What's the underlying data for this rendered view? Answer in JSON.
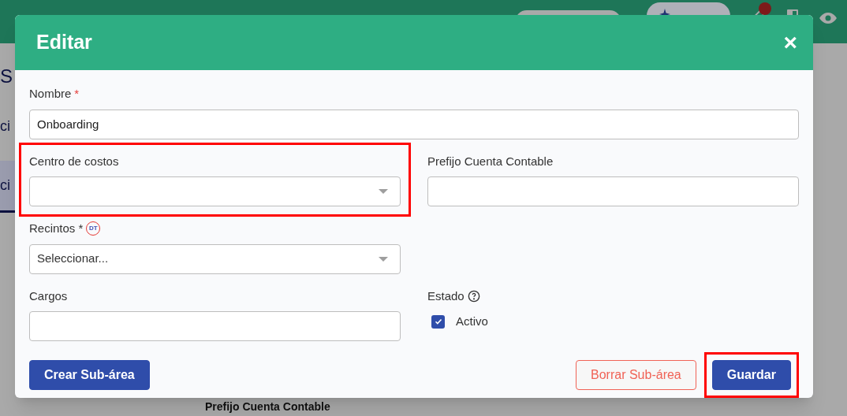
{
  "page": {
    "heading": "S",
    "tabs": [
      {
        "label": "ci",
        "selected": false
      },
      {
        "label": "ci",
        "selected": true
      }
    ],
    "topbar": {
      "notification": true
    },
    "footer_label": "Prefijo Cuenta Contable"
  },
  "dialog": {
    "title": "Editar",
    "close": "×",
    "fields": [
      {
        "kind": "text",
        "label": "Nombre",
        "required_mark": "*",
        "value": "Onboarding",
        "wide": true
      },
      {
        "kind": "select",
        "label": "Centro de costos",
        "highlighted": true
      },
      {
        "kind": "text",
        "label": "Prefijo Cuenta Contable"
      },
      {
        "kind": "select",
        "label": "Recintos *",
        "badge": "DT",
        "placeholder": "Seleccionar..."
      },
      {
        "kind": "spacer"
      },
      {
        "kind": "text",
        "label": "Cargos"
      },
      {
        "kind": "checkbox",
        "label": "Estado",
        "help": true,
        "option": "Activo",
        "checked": true
      }
    ],
    "buttons": [
      {
        "kind": "primary",
        "label": "Crear Sub-área"
      },
      {
        "kind": "spacer"
      },
      {
        "kind": "danger",
        "label": "Borrar Sub-área"
      },
      {
        "kind": "primary",
        "label": "Guardar",
        "highlighted": true
      }
    ]
  }
}
